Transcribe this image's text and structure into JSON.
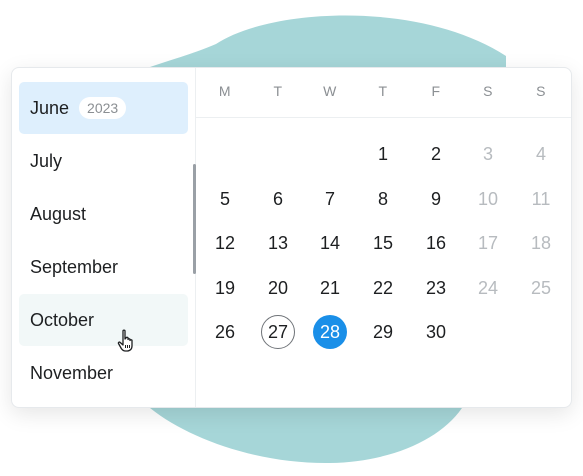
{
  "months_panel": {
    "year": "2023",
    "items": [
      {
        "label": "June",
        "state": "selected"
      },
      {
        "label": "July",
        "state": ""
      },
      {
        "label": "August",
        "state": ""
      },
      {
        "label": "September",
        "state": ""
      },
      {
        "label": "October",
        "state": "hover"
      },
      {
        "label": "November",
        "state": ""
      }
    ]
  },
  "calendar": {
    "weekdays": [
      "M",
      "T",
      "W",
      "T",
      "F",
      "S",
      "S"
    ],
    "weeks": [
      [
        null,
        null,
        null,
        {
          "d": "1"
        },
        {
          "d": "2"
        },
        {
          "d": "3",
          "muted": true
        },
        {
          "d": "4",
          "muted": true
        }
      ],
      [
        {
          "d": "5"
        },
        {
          "d": "6"
        },
        {
          "d": "7"
        },
        {
          "d": "8"
        },
        {
          "d": "9"
        },
        {
          "d": "10",
          "muted": true
        },
        {
          "d": "11",
          "muted": true
        }
      ],
      [
        {
          "d": "12"
        },
        {
          "d": "13"
        },
        {
          "d": "14"
        },
        {
          "d": "15"
        },
        {
          "d": "16"
        },
        {
          "d": "17",
          "muted": true
        },
        {
          "d": "18",
          "muted": true
        }
      ],
      [
        {
          "d": "19"
        },
        {
          "d": "20"
        },
        {
          "d": "21"
        },
        {
          "d": "22"
        },
        {
          "d": "23"
        },
        {
          "d": "24",
          "muted": true
        },
        {
          "d": "25",
          "muted": true
        }
      ],
      [
        {
          "d": "26"
        },
        {
          "d": "27",
          "today": true
        },
        {
          "d": "28",
          "selected": true
        },
        {
          "d": "29"
        },
        {
          "d": "30"
        },
        null,
        null
      ]
    ]
  },
  "colors": {
    "accent": "#1a8fe8",
    "selected_month_bg": "#deeffd",
    "background_blob": "#a6d6d8"
  },
  "icons": {
    "cursor": "hand-pointer-icon"
  }
}
